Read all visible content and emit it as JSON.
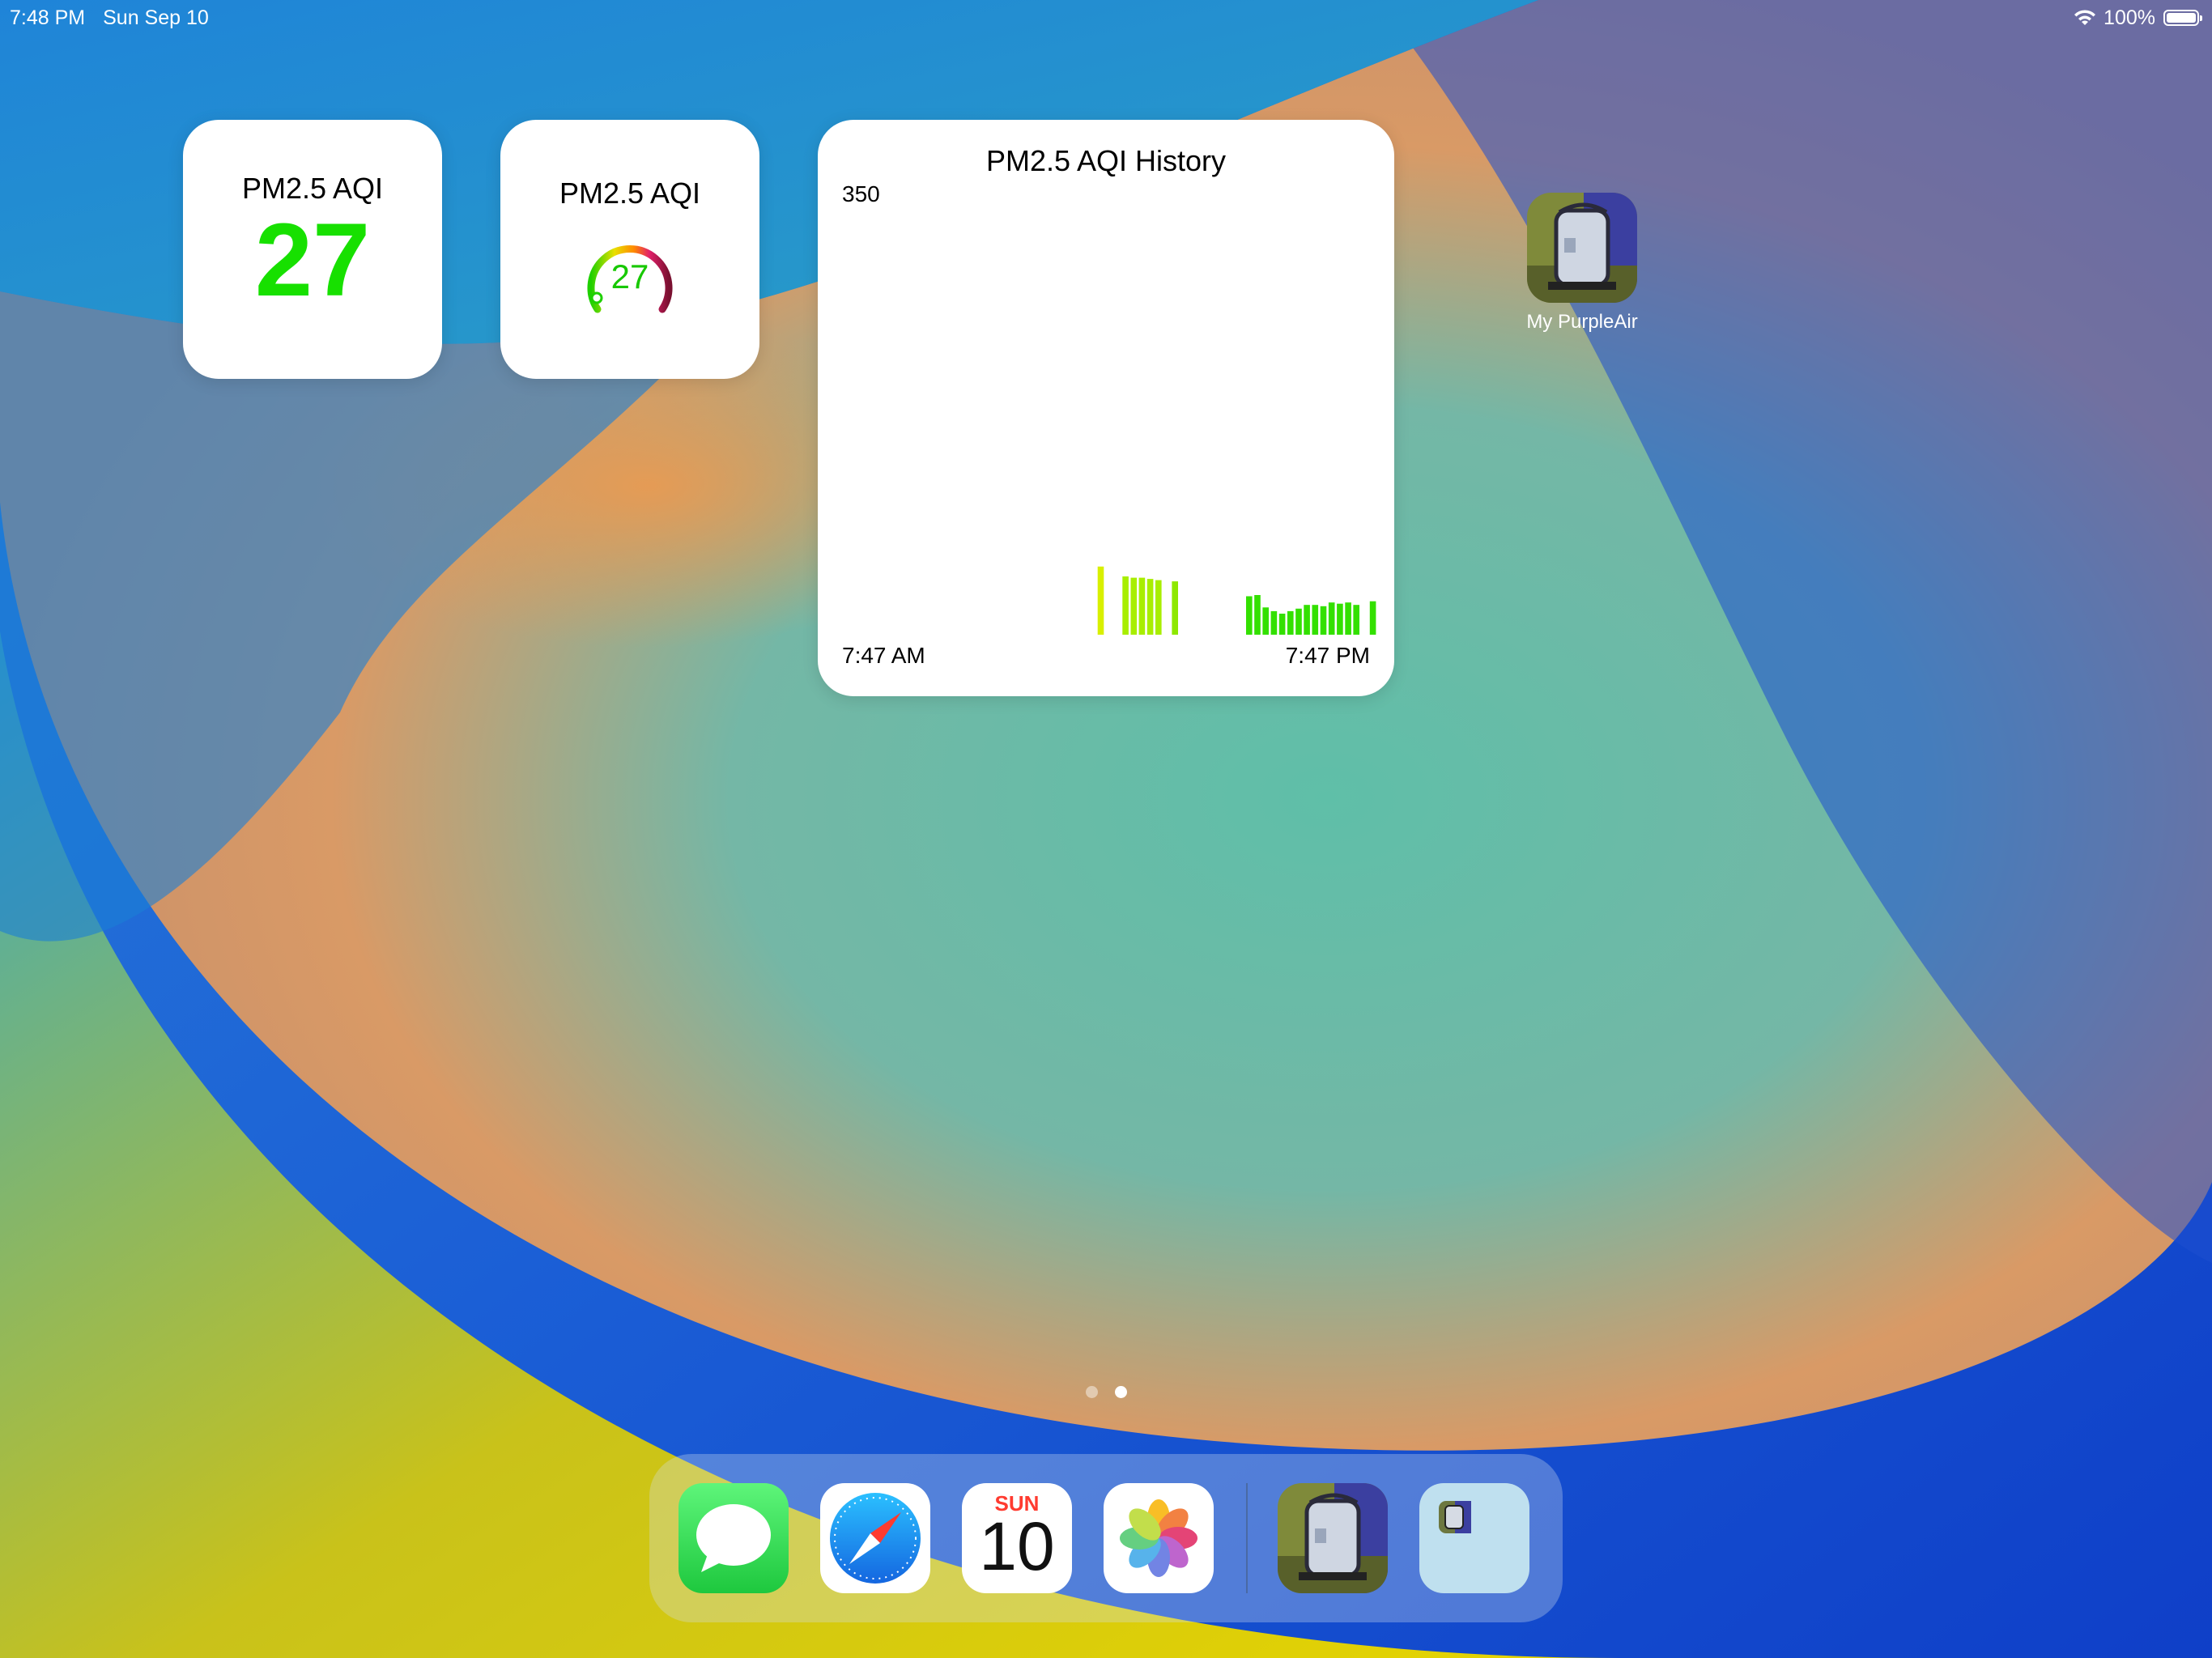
{
  "status_bar": {
    "time": "7:48 PM",
    "date": "Sun Sep 10",
    "battery": "100%"
  },
  "widgets": {
    "aqi_number": {
      "title": "PM2.5 AQI",
      "value": "27"
    },
    "aqi_gauge": {
      "title": "PM2.5 AQI",
      "value": "27",
      "level": 27
    },
    "aqi_history": {
      "title": "PM2.5 AQI History",
      "y_max_label": "350",
      "x_start_label": "7:47 AM",
      "x_end_label": "7:47 PM"
    }
  },
  "home_apps": [
    {
      "label": "My PurpleAir",
      "icon": "purpleair-sensor-icon"
    }
  ],
  "dock": {
    "apps": [
      {
        "name": "Messages",
        "icon": "messages-icon"
      },
      {
        "name": "Safari",
        "icon": "safari-compass-icon"
      },
      {
        "name": "Calendar",
        "icon": "calendar-icon",
        "day": "SUN",
        "date": "10"
      },
      {
        "name": "Photos",
        "icon": "photos-flower-icon"
      },
      {
        "name": "My PurpleAir",
        "icon": "purpleair-sensor-icon"
      },
      {
        "name": "Recent App",
        "icon": "recent-app-icon"
      }
    ]
  },
  "pages": {
    "count": 2,
    "current": 2
  },
  "colors": {
    "aqi_good": "#17e000",
    "aqi_moderate": "#d8f000"
  },
  "chart_data": {
    "type": "bar",
    "title": "PM2.5 AQI History",
    "ylim": [
      0,
      350
    ],
    "x_range_labels": [
      "7:47 AM",
      "7:47 PM"
    ],
    "bars": [
      {
        "slot": 31,
        "value": 55,
        "color": "#d8f000"
      },
      {
        "slot": 34,
        "value": 47,
        "color": "#a8ee00"
      },
      {
        "slot": 35,
        "value": 46,
        "color": "#a8ee00"
      },
      {
        "slot": 36,
        "value": 46,
        "color": "#a8ee00"
      },
      {
        "slot": 37,
        "value": 45,
        "color": "#a8ee00"
      },
      {
        "slot": 38,
        "value": 44,
        "color": "#a8ee00"
      },
      {
        "slot": 40,
        "value": 43,
        "color": "#8ee800"
      },
      {
        "slot": 49,
        "value": 31,
        "color": "#33e000"
      },
      {
        "slot": 50,
        "value": 32,
        "color": "#33e000"
      },
      {
        "slot": 51,
        "value": 22,
        "color": "#33e000"
      },
      {
        "slot": 52,
        "value": 19,
        "color": "#33e000"
      },
      {
        "slot": 53,
        "value": 17,
        "color": "#33e000"
      },
      {
        "slot": 54,
        "value": 19,
        "color": "#33e000"
      },
      {
        "slot": 55,
        "value": 21,
        "color": "#33e000"
      },
      {
        "slot": 56,
        "value": 24,
        "color": "#33e000"
      },
      {
        "slot": 57,
        "value": 24,
        "color": "#33e000"
      },
      {
        "slot": 58,
        "value": 23,
        "color": "#33e000"
      },
      {
        "slot": 59,
        "value": 26,
        "color": "#33e000"
      },
      {
        "slot": 60,
        "value": 25,
        "color": "#33e000"
      },
      {
        "slot": 61,
        "value": 26,
        "color": "#33e000"
      },
      {
        "slot": 62,
        "value": 24,
        "color": "#33e000"
      },
      {
        "slot": 64,
        "value": 27,
        "color": "#33e000"
      }
    ],
    "slots": 65
  }
}
